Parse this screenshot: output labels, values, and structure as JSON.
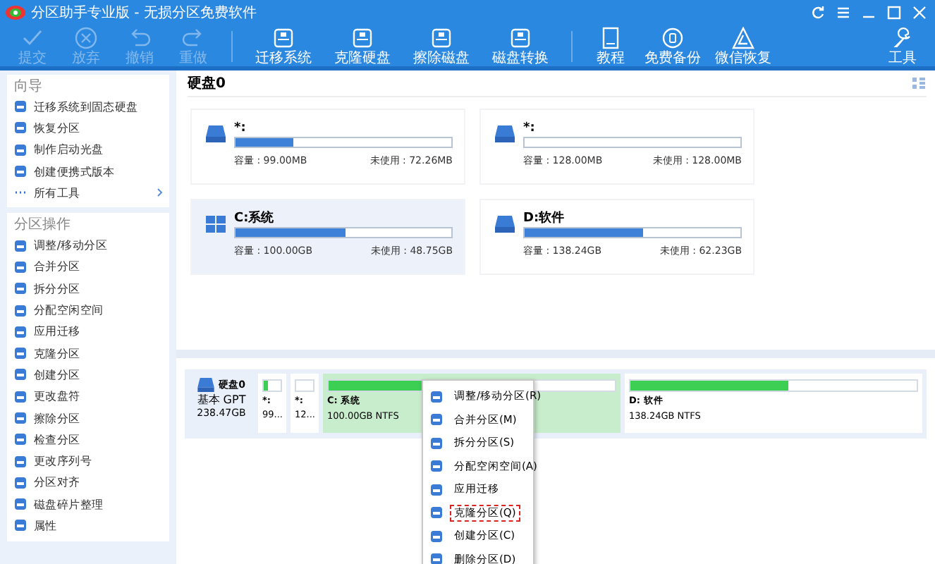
{
  "window": {
    "title": "分区助手专业版 - 无损分区免费软件"
  },
  "toolbar": {
    "items": [
      {
        "label": "提交",
        "disabled": true
      },
      {
        "label": "放弃",
        "disabled": true
      },
      {
        "label": "撤销",
        "disabled": true
      },
      {
        "label": "重做",
        "disabled": true
      },
      {
        "label": "迁移系统",
        "disabled": false
      },
      {
        "label": "克隆硬盘",
        "disabled": false
      },
      {
        "label": "擦除磁盘",
        "disabled": false
      },
      {
        "label": "磁盘转换",
        "disabled": false
      },
      {
        "label": "教程",
        "disabled": false
      },
      {
        "label": "免费备份",
        "disabled": false
      },
      {
        "label": "微信恢复",
        "disabled": false
      }
    ],
    "tools_label": "工具"
  },
  "sidebar": {
    "sections": [
      {
        "title": "向导",
        "items": [
          {
            "label": "迁移系统到固态硬盘",
            "chevron": false
          },
          {
            "label": "恢复分区",
            "chevron": false
          },
          {
            "label": "制作启动光盘",
            "chevron": false
          },
          {
            "label": "创建便携式版本",
            "chevron": false
          },
          {
            "label": "所有工具",
            "chevron": true
          }
        ]
      },
      {
        "title": "分区操作",
        "items": [
          {
            "label": "调整/移动分区",
            "chevron": false
          },
          {
            "label": "合并分区",
            "chevron": false
          },
          {
            "label": "拆分分区",
            "chevron": false
          },
          {
            "label": "分配空闲空间",
            "chevron": false
          },
          {
            "label": "应用迁移",
            "chevron": false
          },
          {
            "label": "克隆分区",
            "chevron": false
          },
          {
            "label": "创建分区",
            "chevron": false
          },
          {
            "label": "更改盘符",
            "chevron": false
          },
          {
            "label": "擦除分区",
            "chevron": false
          },
          {
            "label": "检查分区",
            "chevron": false
          },
          {
            "label": "更改序列号",
            "chevron": false
          },
          {
            "label": "分区对齐",
            "chevron": false
          },
          {
            "label": "磁盘碎片整理",
            "chevron": false
          },
          {
            "label": "属性",
            "chevron": false
          }
        ]
      }
    ]
  },
  "disk_panel": {
    "title": "硬盘0",
    "partitions": [
      {
        "name": "*:",
        "kind": "drive",
        "selected": false,
        "level": 0.27,
        "capacity": "容量 : 99.00MB",
        "free": "未使用 : 72.26MB"
      },
      {
        "name": "*:",
        "kind": "drive",
        "selected": false,
        "level": 0,
        "capacity": "容量 : 128.00MB",
        "free": "未使用 : 128.00MB"
      },
      {
        "name": "C:系统",
        "kind": "windows",
        "selected": true,
        "level": 0.51,
        "capacity": "容量 : 100.00GB",
        "free": "未使用 : 48.75GB"
      },
      {
        "name": "D:软件",
        "kind": "drive",
        "selected": false,
        "level": 0.55,
        "capacity": "容量 : 138.24GB",
        "free": "未使用 : 62.23GB"
      }
    ]
  },
  "disk_map": {
    "disk_name": "硬盘0",
    "disk_type": "基本 GPT",
    "disk_size": "238.47GB",
    "partitions": [
      {
        "name": "*:",
        "info": "99...",
        "level": 0.27,
        "selected": false
      },
      {
        "name": "*:",
        "info": "12...",
        "level": 0,
        "selected": false
      },
      {
        "name": "C: 系统",
        "info": "100.00GB NTFS",
        "level": 0.51,
        "selected": true
      },
      {
        "name": "D: 软件",
        "info": "138.24GB NTFS",
        "level": 0.55,
        "selected": false
      }
    ]
  },
  "context_menu": {
    "items": [
      {
        "label": "调整/移动分区(R)",
        "selected": false
      },
      {
        "label": "合并分区(M)",
        "selected": false
      },
      {
        "label": "拆分分区(S)",
        "selected": false
      },
      {
        "label": "分配空闲空间(A)",
        "selected": false
      },
      {
        "label": "应用迁移",
        "selected": false
      },
      {
        "label": "克隆分区(Q)",
        "selected": true
      },
      {
        "label": "创建分区(C)",
        "selected": false
      },
      {
        "label": "删除分区(D)",
        "selected": false
      }
    ]
  }
}
